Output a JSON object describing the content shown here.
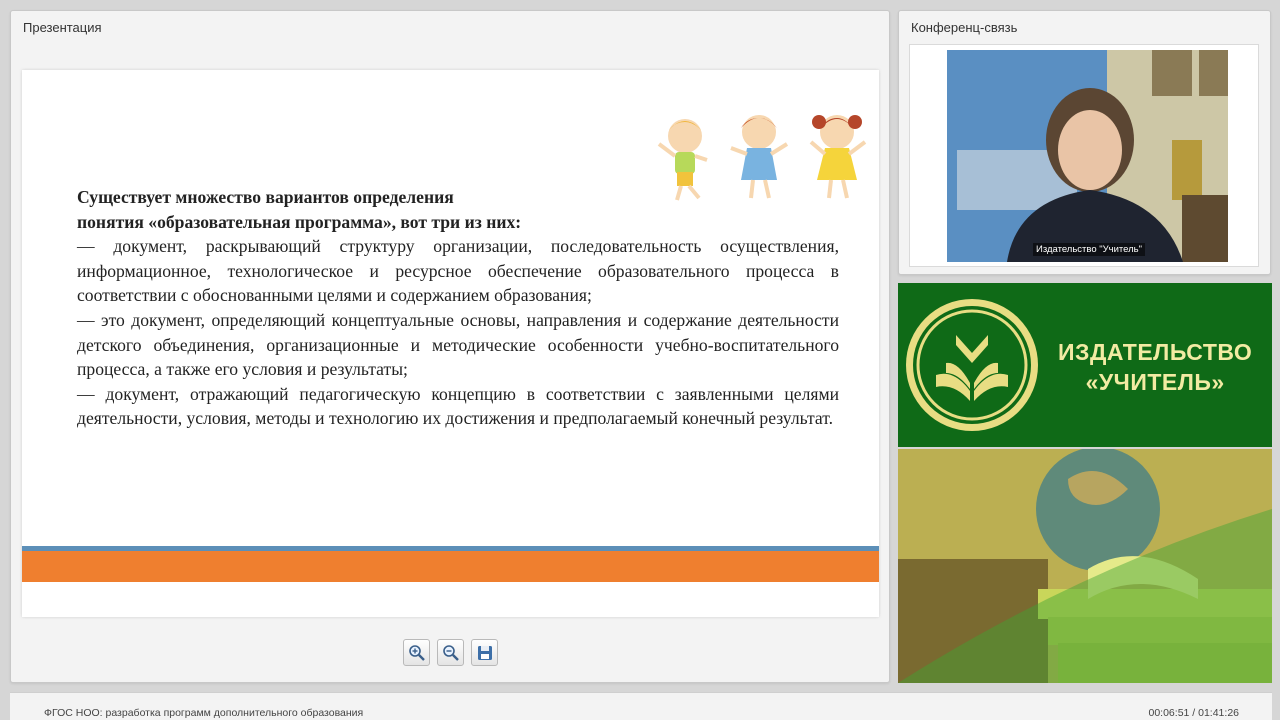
{
  "presentation_panel": {
    "title": "Презентация",
    "slide": {
      "heading_line1": "Существует множество вариантов определения",
      "heading_line2": "понятия «образовательная программа», вот три из них:",
      "item1": "— документ, раскрывающий структуру организации, последовательность осуществления, информационное, технологическое и ресурсное обеспечение образовательного процесса в соответствии с обоснованными целями и содержанием образования;",
      "item2": "— это документ, определяющий концептуальные основы, направления и содержание деятельности детского объединения, организационные и методические особенности учебно-воспитательного процесса, а также его условия и результаты;",
      "item3": "— документ, отражающий педагогическую концепцию в соответствии с заявленными целями деятельности, условия, методы и технологию их достижения и предполагаемый конечный результат."
    },
    "toolbar": {
      "zoom_in_icon": "zoom-in-icon",
      "zoom_out_icon": "zoom-out-icon",
      "save_icon": "save-icon"
    }
  },
  "conference_panel": {
    "title": "Конференц-связь",
    "speaker_label": "Издательство \"Учитель\""
  },
  "brand": {
    "line1": "ИЗДАТЕЛЬСТВО",
    "line2": "«УЧИТЕЛЬ»",
    "color_bg": "#0f6a17",
    "color_text": "#f2eba3"
  },
  "footer": {
    "title": "ФГОС НОО: разработка программ дополнительного образования",
    "time": "00:06:51 / 01:41:26"
  },
  "colors": {
    "slide_orange": "#ef7f2f",
    "slide_blue": "#5c8fb8"
  }
}
